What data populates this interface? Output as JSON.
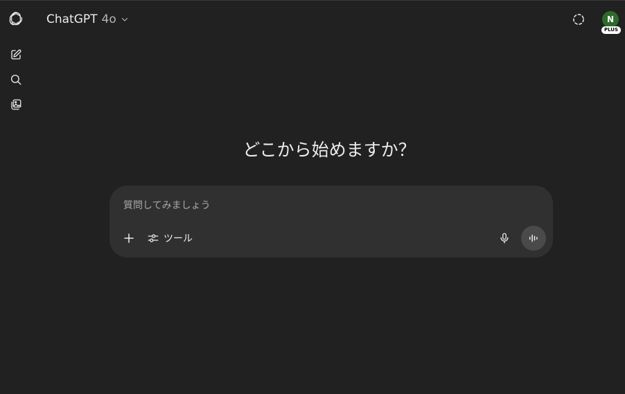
{
  "header": {
    "model_name": "ChatGPT",
    "model_version": "4o"
  },
  "account": {
    "avatar_initial": "N",
    "plan_badge": "PLUS"
  },
  "main": {
    "headline": "どこから始めますか？"
  },
  "composer": {
    "placeholder": "質問してみましょう",
    "value": "",
    "tools_label": "ツール"
  },
  "colors": {
    "background": "#212121",
    "composer_background": "#303030",
    "avatar_background": "#2e6b2b",
    "text": "#ececec",
    "voice_button": "#4a4a4a"
  },
  "icons": {
    "logo": "openai-logo-icon",
    "new_chat": "new-chat-icon",
    "search": "search-icon",
    "library": "image-library-icon",
    "temporary_chat": "temporary-chat-icon",
    "chevron": "chevron-down-icon",
    "attach": "plus-icon",
    "tools": "sliders-icon",
    "mic": "microphone-icon",
    "voice": "voice-waveform-icon"
  }
}
